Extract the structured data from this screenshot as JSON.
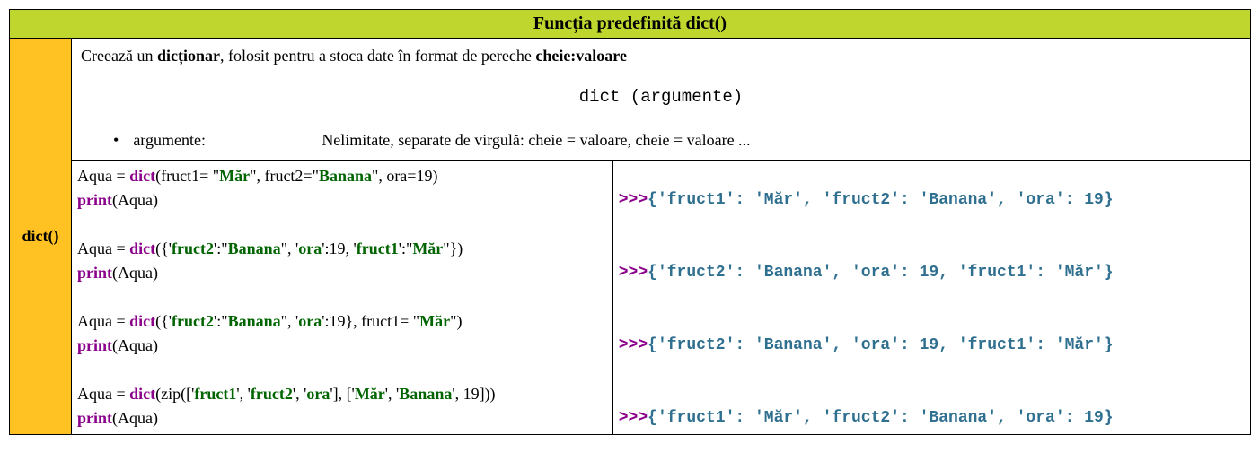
{
  "header": {
    "title": "Funcția predefinită dict()"
  },
  "side": {
    "label": "dict()"
  },
  "desc": {
    "prefix": "Creează un ",
    "bold1": "dicționar",
    "middle": ", folosit pentru a stoca date în format de pereche ",
    "bold2": "cheie:valoare",
    "syntax": "dict (argumente)",
    "bullet_label": "argumente:",
    "bullet_text": "Nelimitate, separate de virgulă: cheie = valoare, cheie = valoare ..."
  },
  "code": {
    "l1_a": "Aqua = ",
    "l1_b": "dict",
    "l1_c": "(fruct1= \"",
    "l1_d": "Măr",
    "l1_e": "\", fruct2=\"",
    "l1_f": "Banana",
    "l1_g": "\", ora=19)",
    "l2_a": "print",
    "l2_b": "(Aqua)",
    "l3_a": "Aqua = ",
    "l3_b": "dict",
    "l3_c": "({'",
    "l3_d": "fruct2",
    "l3_e": "':\"",
    "l3_f": "Banana",
    "l3_g": "\", '",
    "l3_h": "ora",
    "l3_i": "':19, '",
    "l3_j": "fruct1",
    "l3_k": "':\"",
    "l3_l": "Măr",
    "l3_m": "\"})",
    "l4_a": "print",
    "l4_b": "(Aqua)",
    "l5_a": "Aqua = ",
    "l5_b": "dict",
    "l5_c": "({'",
    "l5_d": "fruct2",
    "l5_e": "':\"",
    "l5_f": "Banana",
    "l5_g": "\", '",
    "l5_h": "ora",
    "l5_i": "':19}, fruct1= \"",
    "l5_j": "Măr",
    "l5_k": "\")",
    "l6_a": "print",
    "l6_b": "(Aqua)",
    "l7_a": "Aqua = ",
    "l7_b": "dict",
    "l7_c": "(zip(['",
    "l7_d": "fruct1",
    "l7_e": "', '",
    "l7_f": "fruct2",
    "l7_g": "', '",
    "l7_h": "ora",
    "l7_i": "'], ['",
    "l7_j": "Măr",
    "l7_k": "', '",
    "l7_l": "Banana",
    "l7_m": "', 19]))",
    "l8_a": "print",
    "l8_b": "(Aqua)"
  },
  "output": {
    "p": ">>>",
    "o1": "{'fruct1': 'Măr', 'fruct2': 'Banana', 'ora': 19}",
    "o2": "{'fruct2': 'Banana', 'ora': 19, 'fruct1': 'Măr'}",
    "o3": "{'fruct2': 'Banana', 'ora': 19, 'fruct1': 'Măr'}",
    "o4": "{'fruct1': 'Măr', 'fruct2': 'Banana', 'ora': 19}"
  }
}
